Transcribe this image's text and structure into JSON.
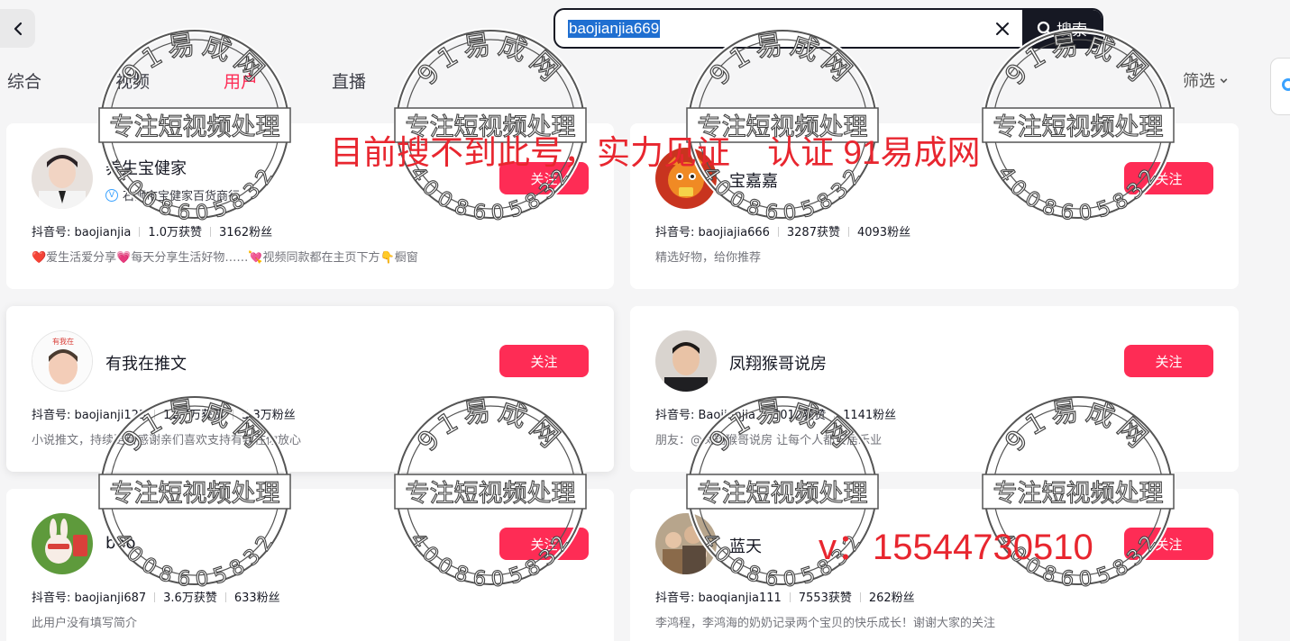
{
  "search": {
    "query": "baojianjia669",
    "button_label": "搜索"
  },
  "tabs": [
    {
      "label": "综合"
    },
    {
      "label": "视频"
    },
    {
      "label": "用户"
    },
    {
      "label": "直播"
    }
  ],
  "filter_label": "筛选",
  "overlay": {
    "notice": "目前搜不到此号，实力见证    认证 91易成网",
    "contact": "v：15544730510"
  },
  "watermark": {
    "top": "91易成网",
    "band": "专注短视频处理",
    "bottom": "4008605832"
  },
  "users": [
    {
      "name": "养生宝健家",
      "verified": "石狮市宝健家百货商行",
      "douyin_id": "抖音号: baojianjia",
      "likes": "1.0万获赞",
      "fans": "3162粉丝",
      "bio": "❤️爱生活爱分享💗每天分享生活好物……💘视频同款都在主页下方👇橱窗",
      "follow": "关注"
    },
    {
      "name": "宝嘉嘉",
      "douyin_id": "抖音号: baojiajia666",
      "likes": "3287获赞",
      "fans": "4093粉丝",
      "bio": "精选好物，给你推荐",
      "follow": "关注"
    },
    {
      "name": "有我在推文",
      "douyin_id": "抖音号: baojianji123",
      "likes": "11.7万获赞",
      "fans": "5.3万粉丝",
      "bio": "小说推文，持续更新感谢亲们喜欢支持有我在你放心",
      "follow": "关注"
    },
    {
      "name": "凤翔猴哥说房",
      "douyin_id": "抖音号: Baojianjia",
      "likes": "3012获赞",
      "fans": "1141粉丝",
      "bio": "朋友：@凤翔猴哥说房 让每个人都安居乐业",
      "follow": "关注"
    },
    {
      "name": "bao",
      "douyin_id": "抖音号: baojianji687",
      "likes": "3.6万获赞",
      "fans": "633粉丝",
      "bio": "此用户没有填写简介",
      "follow": "关注"
    },
    {
      "name": "蓝天",
      "douyin_id": "抖音号: baoqianjia111",
      "likes": "7553获赞",
      "fans": "262粉丝",
      "bio": "李鸿程，李鸿海的奶奶记录两个宝贝的快乐成长！谢谢大家的关注",
      "follow": "关注"
    }
  ]
}
